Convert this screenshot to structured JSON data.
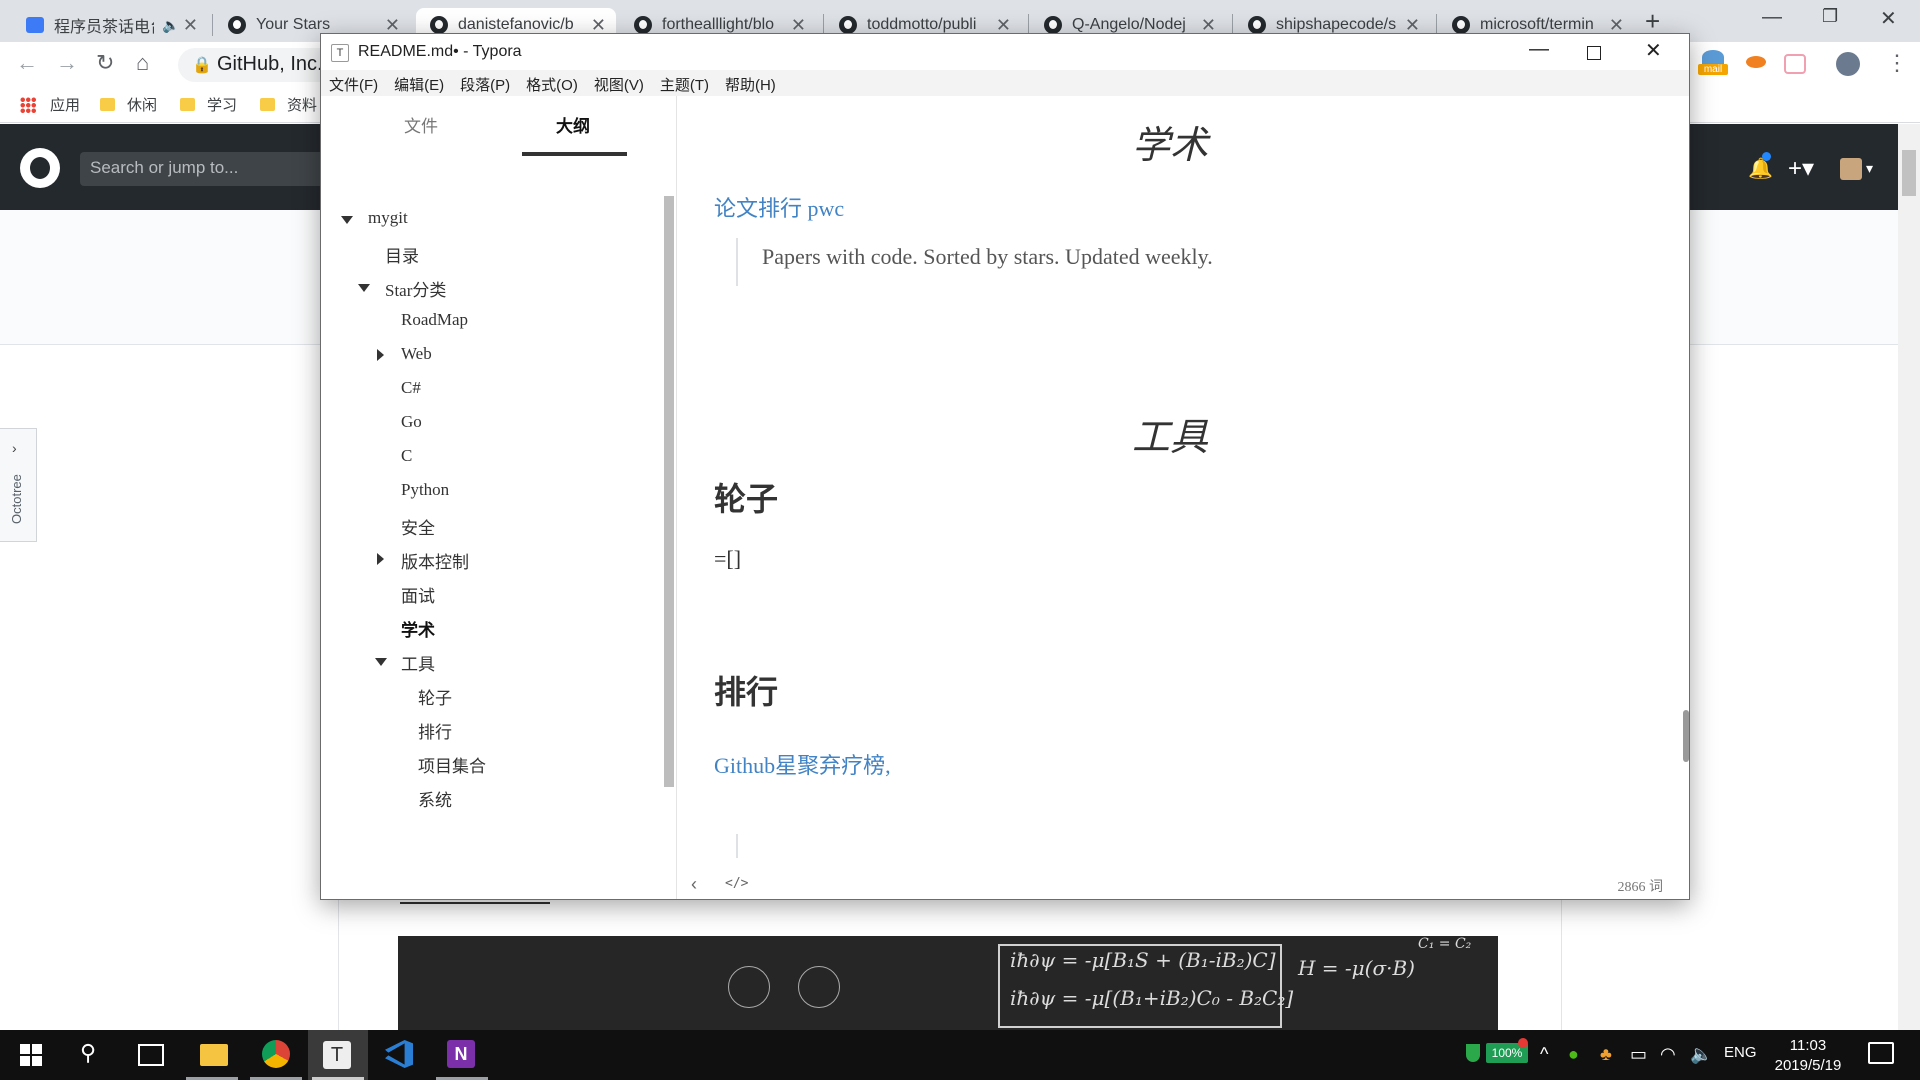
{
  "browser": {
    "tabs": [
      {
        "title": "程序员茶话电台",
        "muted": true
      },
      {
        "title": "Your Stars"
      },
      {
        "title": "danistefanovic/b",
        "active": true
      },
      {
        "title": "forthealllight/blo"
      },
      {
        "title": "toddmotto/publi"
      },
      {
        "title": "Q-Angelo/Nodej"
      },
      {
        "title": "shipshapecode/s"
      },
      {
        "title": "microsoft/termin"
      }
    ],
    "omnibox": "GitHub, Inc.",
    "bookmarks": [
      "应用",
      "休闲",
      "学习",
      "资料"
    ],
    "ext_mail_label": "mail"
  },
  "github": {
    "search_placeholder": "Search or jump to...",
    "octotree_label": "Octotree"
  },
  "typora": {
    "title": "README.md• - Typora",
    "menu": [
      "文件(F)",
      "编辑(E)",
      "段落(P)",
      "格式(O)",
      "视图(V)",
      "主题(T)",
      "帮助(H)"
    ],
    "sidebar_tabs": [
      "文件",
      "大纲"
    ],
    "active_sidebar_tab": "大纲",
    "outline": [
      {
        "label": "mygit",
        "level": 0,
        "toggle": "down"
      },
      {
        "label": "目录",
        "level": 1
      },
      {
        "label": "Star分类",
        "level": 1,
        "toggle": "down"
      },
      {
        "label": "RoadMap",
        "level": 2
      },
      {
        "label": "Web",
        "level": 2,
        "toggle": "right"
      },
      {
        "label": "C#",
        "level": 2
      },
      {
        "label": "Go",
        "level": 2
      },
      {
        "label": "C",
        "level": 2
      },
      {
        "label": "Python",
        "level": 2
      },
      {
        "label": "安全",
        "level": 2
      },
      {
        "label": "版本控制",
        "level": 2,
        "toggle": "right"
      },
      {
        "label": "面试",
        "level": 2
      },
      {
        "label": "学术",
        "level": 2,
        "active": true
      },
      {
        "label": "工具",
        "level": 2,
        "toggle": "down"
      },
      {
        "label": "轮子",
        "level": 3
      },
      {
        "label": "排行",
        "level": 3
      },
      {
        "label": "项目集合",
        "level": 3
      },
      {
        "label": "系统",
        "level": 3
      }
    ],
    "editor": {
      "h_academic": "学术",
      "link_pwc": "论文排行 pwc",
      "quote_pwc": "Papers with code. Sorted by stars. Updated weekly.",
      "h_tools": "工具",
      "h_wheels": "轮子",
      "wheels_text": "=[]",
      "h_ranking": "排行",
      "link_github_rank": "Github星聚弃疗榜,"
    },
    "word_count": "2866 词"
  },
  "taskbar": {
    "battery": "100%",
    "lang": "ENG",
    "time": "11:03",
    "date": "2019/5/19"
  },
  "colors": {
    "link": "#4183c4",
    "github_header": "#24292e",
    "taskbar": "#101010"
  }
}
